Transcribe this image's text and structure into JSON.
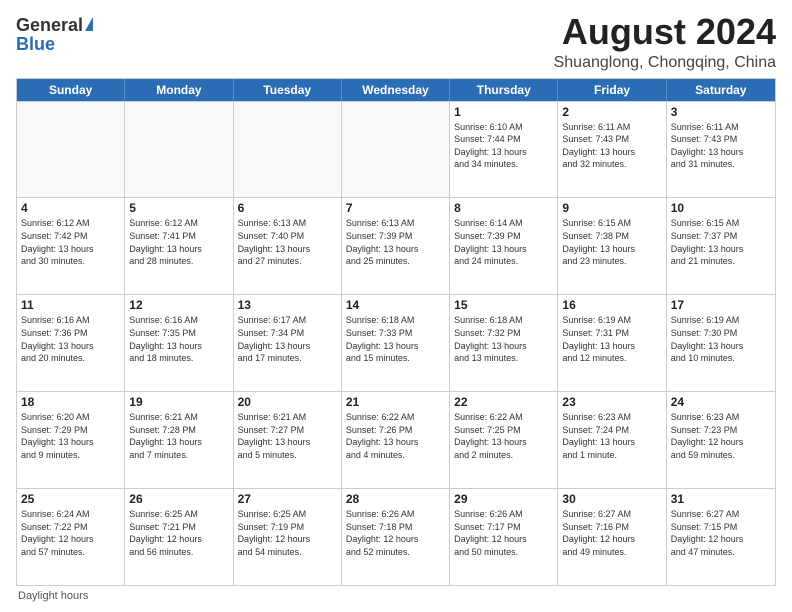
{
  "logo": {
    "general": "General",
    "blue": "Blue"
  },
  "title": "August 2024",
  "subtitle": "Shuanglong, Chongqing, China",
  "days_header": [
    "Sunday",
    "Monday",
    "Tuesday",
    "Wednesday",
    "Thursday",
    "Friday",
    "Saturday"
  ],
  "weeks": [
    [
      {
        "day": "",
        "info": ""
      },
      {
        "day": "",
        "info": ""
      },
      {
        "day": "",
        "info": ""
      },
      {
        "day": "",
        "info": ""
      },
      {
        "day": "1",
        "info": "Sunrise: 6:10 AM\nSunset: 7:44 PM\nDaylight: 13 hours\nand 34 minutes."
      },
      {
        "day": "2",
        "info": "Sunrise: 6:11 AM\nSunset: 7:43 PM\nDaylight: 13 hours\nand 32 minutes."
      },
      {
        "day": "3",
        "info": "Sunrise: 6:11 AM\nSunset: 7:43 PM\nDaylight: 13 hours\nand 31 minutes."
      }
    ],
    [
      {
        "day": "4",
        "info": "Sunrise: 6:12 AM\nSunset: 7:42 PM\nDaylight: 13 hours\nand 30 minutes."
      },
      {
        "day": "5",
        "info": "Sunrise: 6:12 AM\nSunset: 7:41 PM\nDaylight: 13 hours\nand 28 minutes."
      },
      {
        "day": "6",
        "info": "Sunrise: 6:13 AM\nSunset: 7:40 PM\nDaylight: 13 hours\nand 27 minutes."
      },
      {
        "day": "7",
        "info": "Sunrise: 6:13 AM\nSunset: 7:39 PM\nDaylight: 13 hours\nand 25 minutes."
      },
      {
        "day": "8",
        "info": "Sunrise: 6:14 AM\nSunset: 7:39 PM\nDaylight: 13 hours\nand 24 minutes."
      },
      {
        "day": "9",
        "info": "Sunrise: 6:15 AM\nSunset: 7:38 PM\nDaylight: 13 hours\nand 23 minutes."
      },
      {
        "day": "10",
        "info": "Sunrise: 6:15 AM\nSunset: 7:37 PM\nDaylight: 13 hours\nand 21 minutes."
      }
    ],
    [
      {
        "day": "11",
        "info": "Sunrise: 6:16 AM\nSunset: 7:36 PM\nDaylight: 13 hours\nand 20 minutes."
      },
      {
        "day": "12",
        "info": "Sunrise: 6:16 AM\nSunset: 7:35 PM\nDaylight: 13 hours\nand 18 minutes."
      },
      {
        "day": "13",
        "info": "Sunrise: 6:17 AM\nSunset: 7:34 PM\nDaylight: 13 hours\nand 17 minutes."
      },
      {
        "day": "14",
        "info": "Sunrise: 6:18 AM\nSunset: 7:33 PM\nDaylight: 13 hours\nand 15 minutes."
      },
      {
        "day": "15",
        "info": "Sunrise: 6:18 AM\nSunset: 7:32 PM\nDaylight: 13 hours\nand 13 minutes."
      },
      {
        "day": "16",
        "info": "Sunrise: 6:19 AM\nSunset: 7:31 PM\nDaylight: 13 hours\nand 12 minutes."
      },
      {
        "day": "17",
        "info": "Sunrise: 6:19 AM\nSunset: 7:30 PM\nDaylight: 13 hours\nand 10 minutes."
      }
    ],
    [
      {
        "day": "18",
        "info": "Sunrise: 6:20 AM\nSunset: 7:29 PM\nDaylight: 13 hours\nand 9 minutes."
      },
      {
        "day": "19",
        "info": "Sunrise: 6:21 AM\nSunset: 7:28 PM\nDaylight: 13 hours\nand 7 minutes."
      },
      {
        "day": "20",
        "info": "Sunrise: 6:21 AM\nSunset: 7:27 PM\nDaylight: 13 hours\nand 5 minutes."
      },
      {
        "day": "21",
        "info": "Sunrise: 6:22 AM\nSunset: 7:26 PM\nDaylight: 13 hours\nand 4 minutes."
      },
      {
        "day": "22",
        "info": "Sunrise: 6:22 AM\nSunset: 7:25 PM\nDaylight: 13 hours\nand 2 minutes."
      },
      {
        "day": "23",
        "info": "Sunrise: 6:23 AM\nSunset: 7:24 PM\nDaylight: 13 hours\nand 1 minute."
      },
      {
        "day": "24",
        "info": "Sunrise: 6:23 AM\nSunset: 7:23 PM\nDaylight: 12 hours\nand 59 minutes."
      }
    ],
    [
      {
        "day": "25",
        "info": "Sunrise: 6:24 AM\nSunset: 7:22 PM\nDaylight: 12 hours\nand 57 minutes."
      },
      {
        "day": "26",
        "info": "Sunrise: 6:25 AM\nSunset: 7:21 PM\nDaylight: 12 hours\nand 56 minutes."
      },
      {
        "day": "27",
        "info": "Sunrise: 6:25 AM\nSunset: 7:19 PM\nDaylight: 12 hours\nand 54 minutes."
      },
      {
        "day": "28",
        "info": "Sunrise: 6:26 AM\nSunset: 7:18 PM\nDaylight: 12 hours\nand 52 minutes."
      },
      {
        "day": "29",
        "info": "Sunrise: 6:26 AM\nSunset: 7:17 PM\nDaylight: 12 hours\nand 50 minutes."
      },
      {
        "day": "30",
        "info": "Sunrise: 6:27 AM\nSunset: 7:16 PM\nDaylight: 12 hours\nand 49 minutes."
      },
      {
        "day": "31",
        "info": "Sunrise: 6:27 AM\nSunset: 7:15 PM\nDaylight: 12 hours\nand 47 minutes."
      }
    ]
  ],
  "footer": {
    "label": "Daylight hours"
  }
}
